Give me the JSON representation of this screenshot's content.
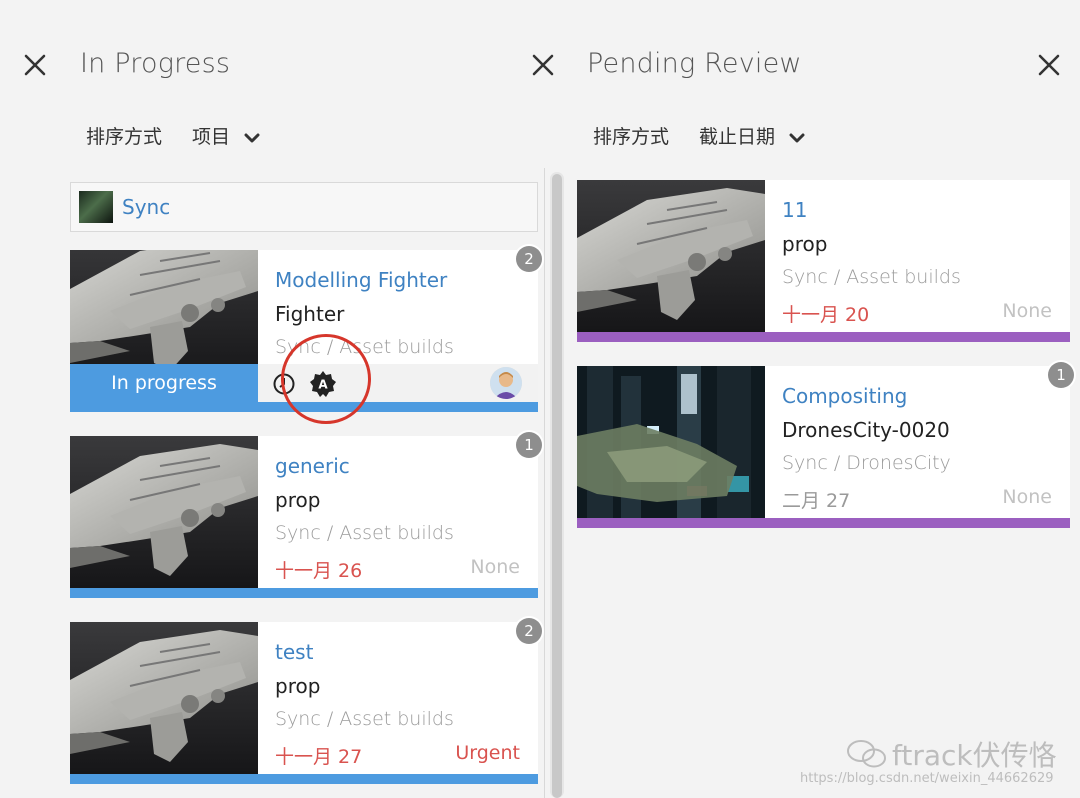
{
  "columns": [
    {
      "title": "In Progress",
      "sort_label": "排序方式",
      "sort_value": "项目",
      "project": {
        "name": "Sync"
      },
      "cards": [
        {
          "task": "Modelling Fighter",
          "name": "Fighter",
          "path": "Sync / Asset builds",
          "badge": "2",
          "status": "In progress"
        },
        {
          "task": "generic",
          "name": "prop",
          "path": "Sync / Asset builds",
          "date": "十一月 26",
          "priority": "None",
          "badge": "1"
        },
        {
          "task": "test",
          "name": "prop",
          "path": "Sync / Asset builds",
          "date": "十一月 27",
          "priority": "Urgent",
          "badge": "2"
        }
      ]
    },
    {
      "title": "Pending Review",
      "sort_label": "排序方式",
      "sort_value": "截止日期",
      "cards": [
        {
          "task": "11",
          "name": "prop",
          "path": "Sync / Asset builds",
          "date": "十一月 20",
          "priority": "None"
        },
        {
          "task": "Compositing",
          "name": "DronesCity-0020",
          "path": "Sync / DronesCity",
          "date": "二月 27",
          "priority": "None",
          "badge": "1"
        }
      ]
    }
  ],
  "colors": {
    "link_blue": "#3f82c2",
    "in_progress_blue": "#4d9be0",
    "pending_purple": "#9b5fc0",
    "overdue_red": "#d9534f",
    "muted": "#c2c2c2",
    "annotation_red": "#d6362b"
  },
  "icons": {
    "clock": "clock-icon",
    "assign": "assign-icon",
    "user": "avatar"
  },
  "watermark": {
    "brand": "ftrack伏传恪",
    "url": "https://blog.csdn.net/weixin_44662629"
  }
}
